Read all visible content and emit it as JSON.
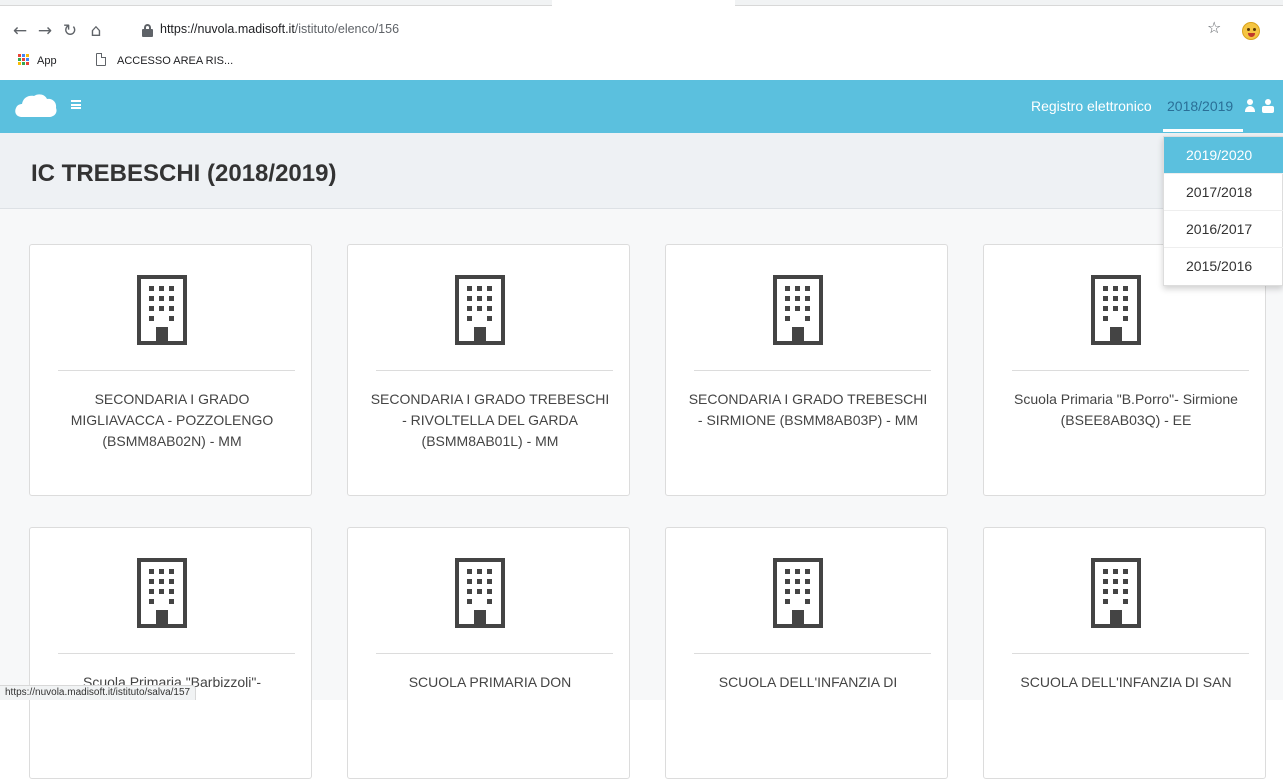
{
  "browser": {
    "url_host": "https://nuvola.madisoft.it",
    "url_path": "/istituto/elenco/156",
    "bookmarks": [
      {
        "label": "App"
      },
      {
        "label": "ACCESSO AREA RIS..."
      }
    ],
    "status_url": "https://nuvola.madisoft.it/istituto/salva/157"
  },
  "header": {
    "label": "Registro elettronico",
    "year": "2018/2019",
    "menu_icon": "hamburger-icon",
    "logo_icon": "cloud-icon",
    "accent_color": "#5bc0de"
  },
  "page": {
    "title": "IC TREBESCHI (2018/2019)"
  },
  "year_dropdown": {
    "options": [
      "2019/2020",
      "2017/2018",
      "2016/2017",
      "2015/2016"
    ],
    "highlighted": "2019/2020"
  },
  "schools": [
    {
      "name": "SECONDARIA I GRADO MIGLIAVACCA - POZZOLENGO (BSMM8AB02N) - MM"
    },
    {
      "name": "SECONDARIA I GRADO TREBESCHI - RIVOLTELLA DEL GARDA (BSMM8AB01L) - MM"
    },
    {
      "name": "SECONDARIA I GRADO TREBESCHI - SIRMIONE (BSMM8AB03P) - MM"
    },
    {
      "name": "Scuola Primaria \"B.Porro\"- Sirmione (BSEE8AB03Q) - EE"
    },
    {
      "name": "Scuola Primaria \"Barbizzoli\"-"
    },
    {
      "name": "SCUOLA PRIMARIA DON"
    },
    {
      "name": "SCUOLA DELL'INFANZIA DI"
    },
    {
      "name": "SCUOLA DELL'INFANZIA DI SAN"
    }
  ]
}
